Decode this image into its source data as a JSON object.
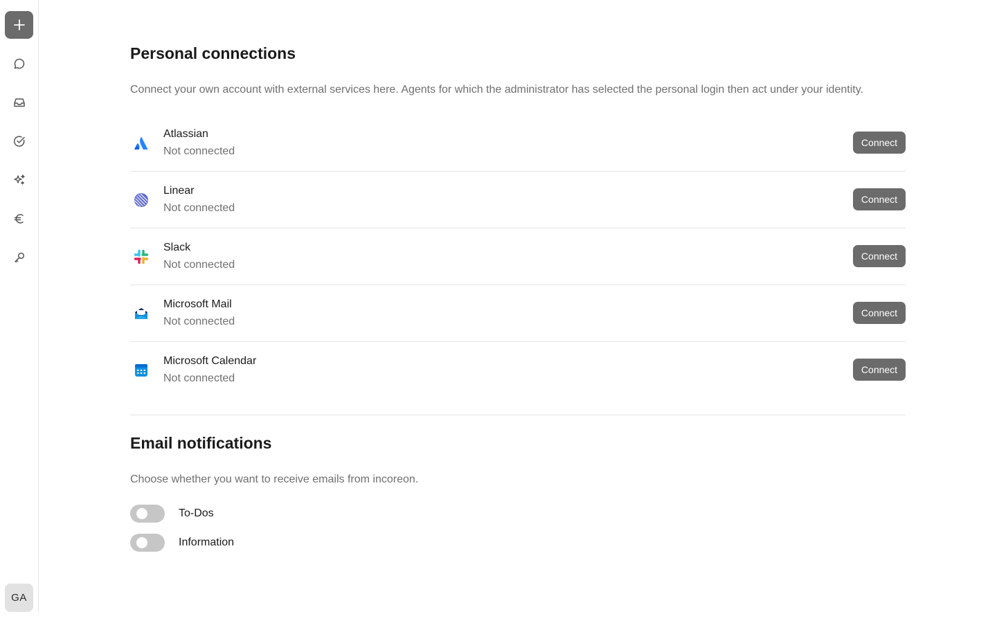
{
  "sidebar": {
    "new_button_icon": "plus-icon",
    "items": [
      {
        "icon": "chat-bubble-icon"
      },
      {
        "icon": "inbox-icon"
      },
      {
        "icon": "check-circle-icon"
      },
      {
        "icon": "sparkles-icon"
      },
      {
        "icon": "euro-icon"
      },
      {
        "icon": "key-icon"
      }
    ],
    "avatar_initials": "GA"
  },
  "personal_connections": {
    "title": "Personal connections",
    "description": "Connect your own account with external services here. Agents for which the administrator has selected the personal login then act under your identity.",
    "services": [
      {
        "name": "Atlassian",
        "status": "Not connected",
        "button": "Connect",
        "icon": "atlassian-icon"
      },
      {
        "name": "Linear",
        "status": "Not connected",
        "button": "Connect",
        "icon": "linear-icon"
      },
      {
        "name": "Slack",
        "status": "Not connected",
        "button": "Connect",
        "icon": "slack-icon"
      },
      {
        "name": "Microsoft Mail",
        "status": "Not connected",
        "button": "Connect",
        "icon": "microsoft-mail-icon"
      },
      {
        "name": "Microsoft Calendar",
        "status": "Not connected",
        "button": "Connect",
        "icon": "microsoft-calendar-icon"
      }
    ]
  },
  "email_notifications": {
    "title": "Email notifications",
    "description": "Choose whether you want to receive emails from incoreon.",
    "toggles": [
      {
        "label": "To-Dos",
        "on": false
      },
      {
        "label": "Information",
        "on": false
      }
    ]
  },
  "colors": {
    "button_bg": "#6b6b6b",
    "toggle_off": "#c6c6c6",
    "divider": "#e4e4e4"
  }
}
